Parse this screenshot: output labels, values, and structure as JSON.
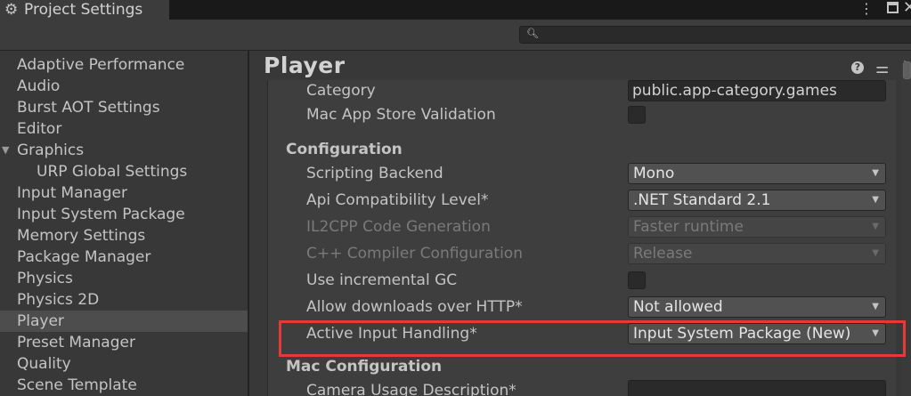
{
  "window": {
    "title": "Project Settings",
    "gear_icon": "gear-icon",
    "menu_icon": "kebab-menu-icon",
    "maximize_icon": "maximize-icon",
    "close_icon": "close-icon"
  },
  "search": {
    "placeholder": "",
    "icon": "search-icon"
  },
  "sidebar": {
    "items": [
      {
        "label": "Adaptive Performance"
      },
      {
        "label": "Audio"
      },
      {
        "label": "Burst AOT Settings"
      },
      {
        "label": "Editor"
      },
      {
        "label": "Graphics"
      },
      {
        "label": "URP Global Settings"
      },
      {
        "label": "Input Manager"
      },
      {
        "label": "Input System Package"
      },
      {
        "label": "Memory Settings"
      },
      {
        "label": "Package Manager"
      },
      {
        "label": "Physics"
      },
      {
        "label": "Physics 2D"
      },
      {
        "label": "Player"
      },
      {
        "label": "Preset Manager"
      },
      {
        "label": "Quality"
      },
      {
        "label": "Scene Template"
      }
    ],
    "selected": "Player"
  },
  "main": {
    "title": "Player",
    "help_icon": "help-icon",
    "presets_icon": "sliders-icon",
    "more_icon": "kebab-menu-icon",
    "category_label": "Category",
    "category_value": "public.app-category.games",
    "mac_app_store_validation_label": "Mac App Store Validation",
    "mac_app_store_validation_checked": false,
    "configuration_header": "Configuration",
    "scripting_backend_label": "Scripting Backend",
    "scripting_backend_value": "Mono",
    "api_compat_label": "Api Compatibility Level*",
    "api_compat_value": ".NET Standard 2.1",
    "il2cpp_codegen_label": "IL2CPP Code Generation",
    "il2cpp_codegen_value": "Faster runtime",
    "cpp_compiler_label": "C++ Compiler Configuration",
    "cpp_compiler_value": "Release",
    "incremental_gc_label": "Use incremental GC",
    "incremental_gc_checked": false,
    "allow_http_label": "Allow downloads over HTTP*",
    "allow_http_value": "Not allowed",
    "active_input_label": "Active Input Handling*",
    "active_input_value": "Input System Package (New)",
    "mac_configuration_header": "Mac Configuration",
    "camera_usage_label": "Camera Usage Description*",
    "camera_usage_value": ""
  },
  "colors": {
    "highlight": "#e53a36",
    "selected_row": "#4d4d4d"
  }
}
